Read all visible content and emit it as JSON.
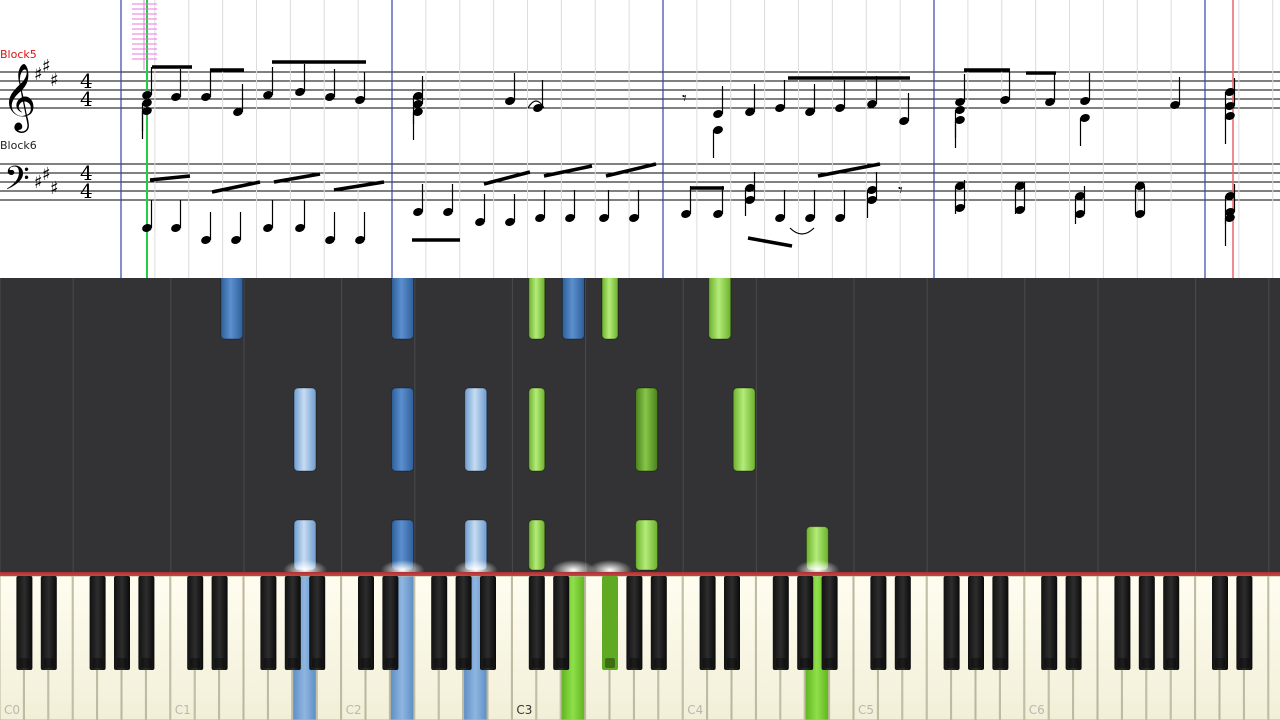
{
  "score": {
    "upper_staff_label": "Block5",
    "lower_staff_label": "Block6",
    "time_signature": [
      "4",
      "4"
    ],
    "key_signature_sharps": 3
  },
  "keyboard": {
    "octave_labels": [
      "C0",
      "C1",
      "C2",
      "C3",
      "C4",
      "C5",
      "C6"
    ],
    "active_label": "C3"
  },
  "colors": {
    "left_hand": "#4a7dbb",
    "left_hand_light": "#9dc1e6",
    "right_hand": "#86cf3e",
    "right_hand_dark": "#5e9e24",
    "roll_background": "#333335",
    "measure_line": "#3344aa",
    "playhead": "#22cc44"
  },
  "falling_notes": [
    {
      "hand": "left",
      "key": "A1",
      "shade": "light",
      "start_beat": 0.0,
      "length": 0.5
    },
    {
      "hand": "left",
      "key": "A1",
      "shade": "light",
      "start_beat": 0.75,
      "length": 0.75
    },
    {
      "hand": "left",
      "key": "E1",
      "shade": "normal",
      "start_beat": 1.75,
      "length": 0.75
    },
    {
      "hand": "left",
      "key": "E1",
      "shade": "normal",
      "start_beat": 2.75,
      "length": 0.75
    },
    {
      "hand": "left",
      "key": "E1",
      "shade": "normal",
      "start_beat": 3.75,
      "length": 0.5
    },
    {
      "hand": "left",
      "key": "E2",
      "shade": "normal",
      "start_beat": 0.0,
      "length": 0.5
    },
    {
      "hand": "left",
      "key": "E2",
      "shade": "normal",
      "start_beat": 0.75,
      "length": 0.75
    },
    {
      "hand": "left",
      "key": "E2",
      "shade": "normal",
      "start_beat": 1.75,
      "length": 0.75
    },
    {
      "hand": "left",
      "key": "E2",
      "shade": "normal",
      "start_beat": 2.75,
      "length": 0.75
    },
    {
      "hand": "left",
      "key": "E2",
      "shade": "normal",
      "start_beat": 3.75,
      "length": 0.5
    },
    {
      "hand": "left",
      "key": "A2",
      "shade": "light",
      "start_beat": 0.0,
      "length": 0.5
    },
    {
      "hand": "left",
      "key": "A2",
      "shade": "light",
      "start_beat": 0.75,
      "length": 0.75
    },
    {
      "hand": "left",
      "key": "E3",
      "shade": "normal",
      "start_beat": 1.75,
      "length": 0.75
    },
    {
      "hand": "left",
      "key": "E3",
      "shade": "normal",
      "start_beat": 2.75,
      "length": 0.75
    },
    {
      "hand": "left",
      "key": "E3",
      "shade": "normal",
      "start_beat": 3.75,
      "length": 0.5
    },
    {
      "hand": "right",
      "key": "C#3",
      "shade": "normal",
      "start_beat": 0.0,
      "length": 0.5
    },
    {
      "hand": "right",
      "key": "C#3",
      "shade": "normal",
      "start_beat": 0.75,
      "length": 0.75
    },
    {
      "hand": "right",
      "key": "C#3",
      "shade": "normal",
      "start_beat": 1.75,
      "length": 0.75
    },
    {
      "hand": "right",
      "key": "A2",
      "shade": "normal",
      "start_beat": 2.75,
      "length": 0.75
    },
    {
      "hand": "right",
      "key": "A2",
      "shade": "normal",
      "start_beat": 3.75,
      "length": 0.5
    },
    {
      "hand": "right",
      "key": "A3",
      "shade": "normal",
      "start_beat": 0.0,
      "length": 0.5
    },
    {
      "hand": "right",
      "key": "A3",
      "shade": "dark",
      "start_beat": 0.75,
      "length": 0.75
    },
    {
      "hand": "right",
      "key": "F#3",
      "shade": "normal",
      "start_beat": 1.75,
      "length": 0.75
    },
    {
      "hand": "right",
      "key": "F#3",
      "shade": "normal",
      "start_beat": 2.75,
      "length": 0.75
    },
    {
      "hand": "right",
      "key": "F#3",
      "shade": "normal",
      "start_beat": 3.75,
      "length": 0.5
    },
    {
      "hand": "right",
      "key": "E4",
      "shade": "normal",
      "start_beat": 0.75,
      "length": 0.75
    },
    {
      "hand": "right",
      "key": "D4",
      "shade": "normal",
      "start_beat": 1.75,
      "length": 0.75
    },
    {
      "hand": "right",
      "key": "C#4",
      "shade": "dark",
      "start_beat": 2.75,
      "length": 0.75
    },
    {
      "hand": "right",
      "key": "A4",
      "shade": "normal",
      "start_beat": 0.0,
      "length": 0.45
    }
  ],
  "pressed_keys": [
    {
      "key": "A1",
      "hand": "left"
    },
    {
      "key": "E2",
      "hand": "left"
    },
    {
      "key": "A2",
      "hand": "left"
    },
    {
      "key": "E3",
      "hand": "right"
    },
    {
      "key": "F#3",
      "hand": "right"
    },
    {
      "key": "A4",
      "hand": "right"
    }
  ]
}
